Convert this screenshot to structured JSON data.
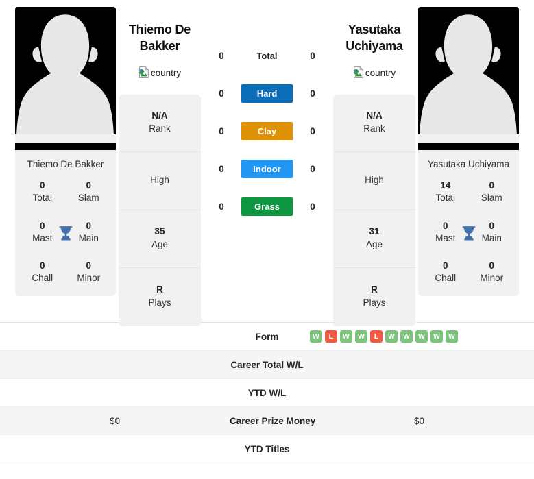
{
  "players": {
    "left": {
      "display_name": "Thiemo De Bakker",
      "heading_line1": "Thiemo De",
      "heading_line2": "Bakker",
      "country_alt": "country",
      "titles": [
        {
          "value": "0",
          "label": "Total"
        },
        {
          "value": "0",
          "label": "Slam"
        },
        {
          "value": "0",
          "label": "Mast"
        },
        {
          "value": "0",
          "label": "Main"
        },
        {
          "value": "0",
          "label": "Chall"
        },
        {
          "value": "0",
          "label": "Minor"
        }
      ],
      "info": [
        {
          "value": "N/A",
          "label": "Rank"
        },
        {
          "value": "",
          "label": "High"
        },
        {
          "value": "35",
          "label": "Age"
        },
        {
          "value": "R",
          "label": "Plays"
        }
      ],
      "surface_scores": [
        "0",
        "0",
        "0",
        "0",
        "0"
      ]
    },
    "right": {
      "display_name": "Yasutaka Uchiyama",
      "heading_line1": "Yasutaka",
      "heading_line2": "Uchiyama",
      "country_alt": "country",
      "titles": [
        {
          "value": "14",
          "label": "Total"
        },
        {
          "value": "0",
          "label": "Slam"
        },
        {
          "value": "0",
          "label": "Mast"
        },
        {
          "value": "0",
          "label": "Main"
        },
        {
          "value": "0",
          "label": "Chall"
        },
        {
          "value": "0",
          "label": "Minor"
        }
      ],
      "info": [
        {
          "value": "N/A",
          "label": "Rank"
        },
        {
          "value": "",
          "label": "High"
        },
        {
          "value": "31",
          "label": "Age"
        },
        {
          "value": "R",
          "label": "Plays"
        }
      ],
      "surface_scores": [
        "0",
        "0",
        "0",
        "0",
        "0"
      ]
    }
  },
  "surfaces": [
    {
      "label": "Total",
      "color": "transparent",
      "plain": true
    },
    {
      "label": "Hard",
      "color": "#0b6cb8",
      "plain": false
    },
    {
      "label": "Clay",
      "color": "#e09206",
      "plain": false
    },
    {
      "label": "Indoor",
      "color": "#2196f3",
      "plain": false
    },
    {
      "label": "Grass",
      "color": "#0c9640",
      "plain": false
    }
  ],
  "stats_rows": [
    {
      "label": "Form",
      "left_value": "",
      "right_value": "",
      "right_form": [
        "W",
        "L",
        "W",
        "W",
        "L",
        "W",
        "W",
        "W",
        "W",
        "W"
      ],
      "striped": false
    },
    {
      "label": "Career Total W/L",
      "left_value": "",
      "right_value": "",
      "striped": true
    },
    {
      "label": "YTD W/L",
      "left_value": "",
      "right_value": "",
      "striped": false
    },
    {
      "label": "Career Prize Money",
      "left_value": "$0",
      "right_value": "$0",
      "striped": true
    },
    {
      "label": "YTD Titles",
      "left_value": "",
      "right_value": "",
      "striped": false
    }
  ],
  "colors": {
    "win": "#7cc47c",
    "loss": "#ef5b44",
    "trophy": "#4371ad",
    "card_bg": "#f1f1f1",
    "stripe": "#f5f5f5"
  }
}
